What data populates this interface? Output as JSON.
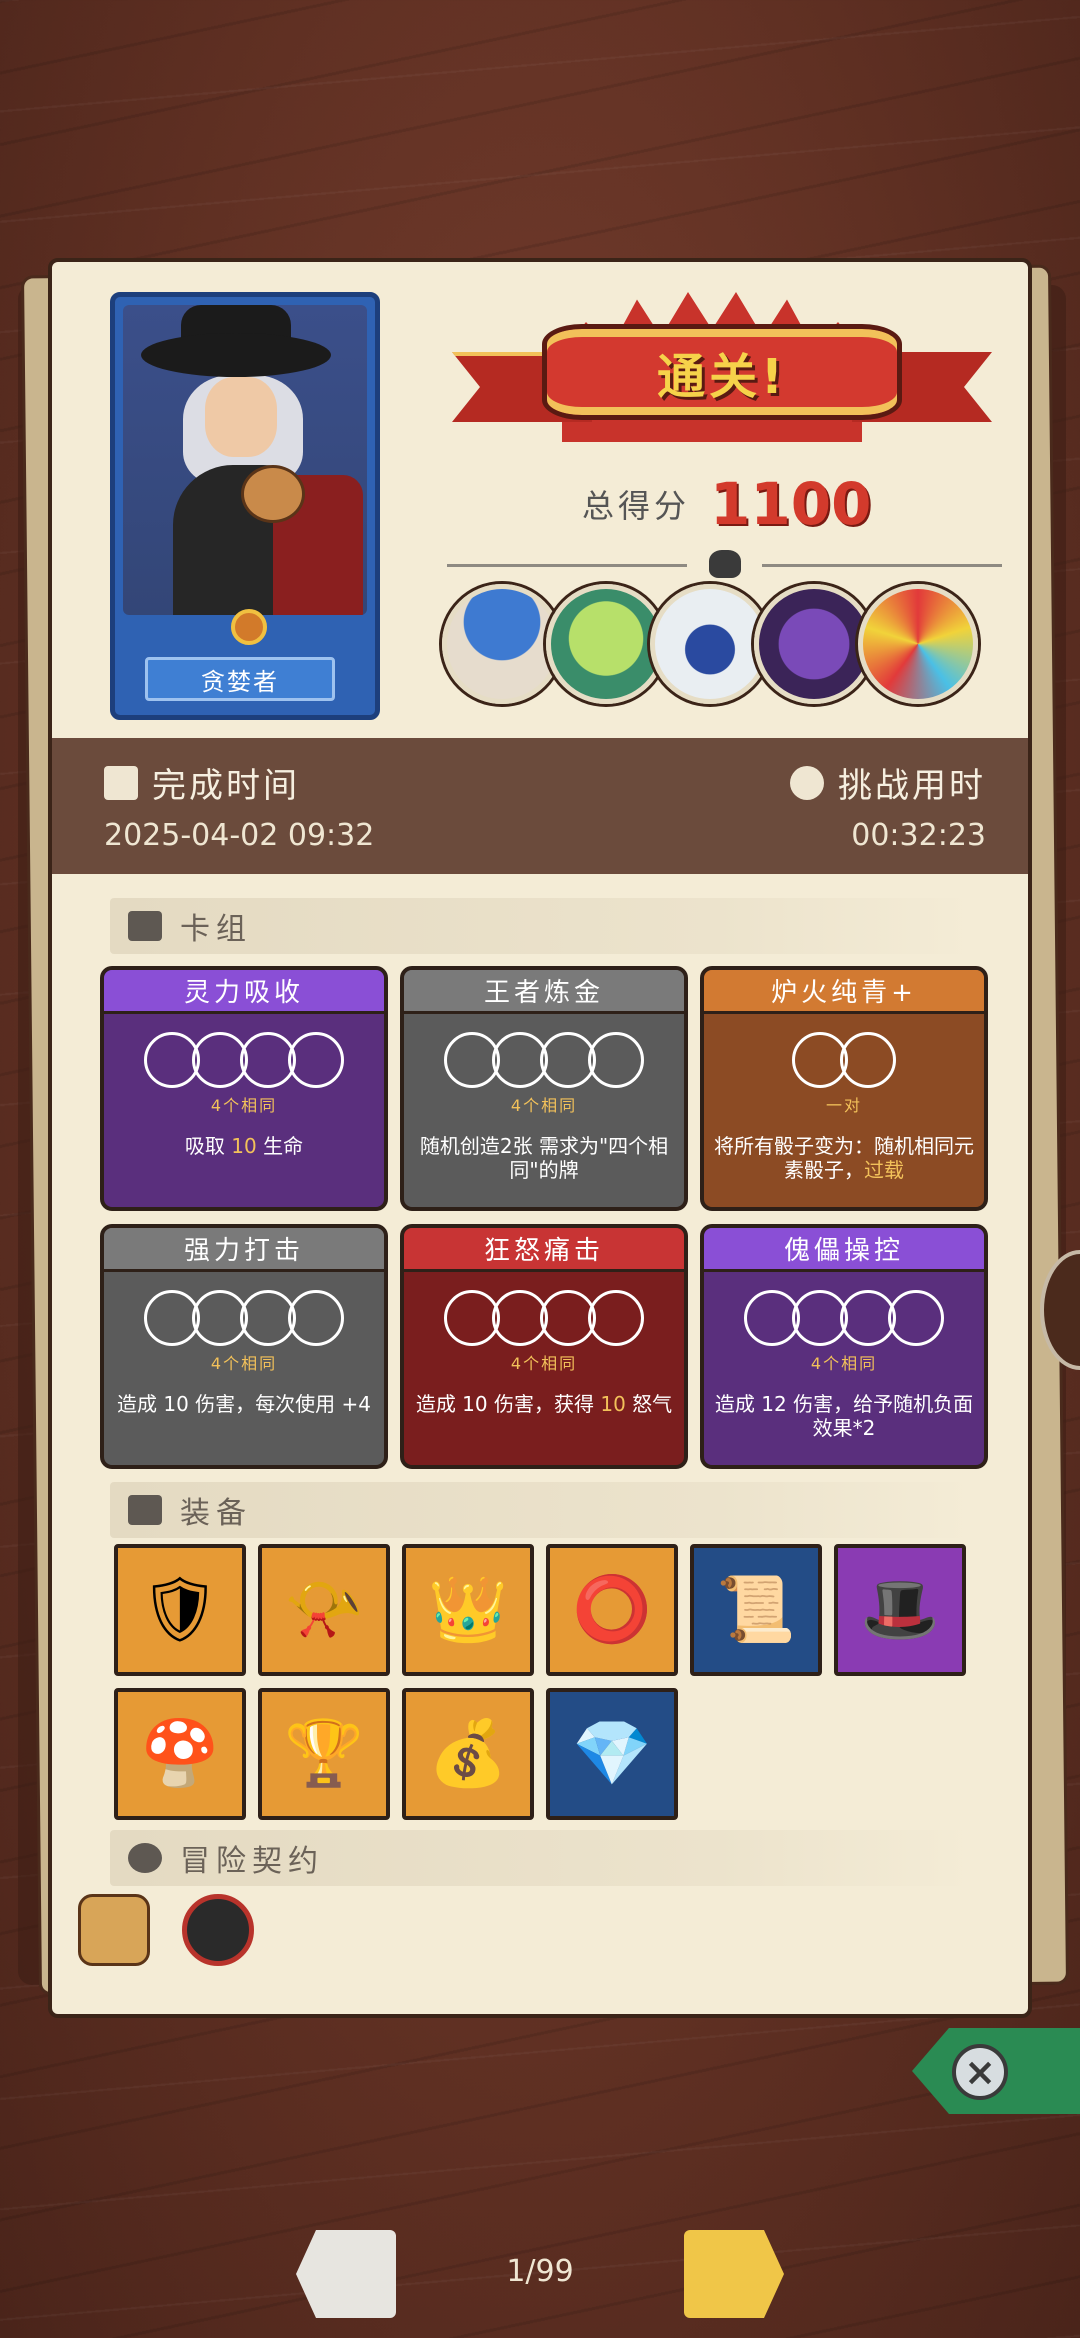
{
  "hero": {
    "name": "贪婪者"
  },
  "result": {
    "banner": "通关!",
    "score_label": "总得分",
    "score_value": "1100"
  },
  "bosses": [
    "boss-mushroom",
    "boss-green-goblin",
    "boss-white-yeti",
    "boss-purple-dragon",
    "boss-rainbow-egg"
  ],
  "times": {
    "finish_label": "完成时间",
    "finish_value": "2025-04-02 09:32",
    "duration_label": "挑战用时",
    "duration_value": "00:32:23"
  },
  "deck": {
    "title": "卡组",
    "cards": [
      {
        "title": "灵力吸收",
        "req": "4个相同",
        "desc_pre": "吸取 ",
        "desc_hl": "10",
        "desc_post": " 生命",
        "color": "purple",
        "circles": 4
      },
      {
        "title": "王者炼金",
        "req": "4个相同",
        "desc_pre": "随机创造2张 需求为\"四个相同\"的牌",
        "desc_hl": "",
        "desc_post": "",
        "color": "gray",
        "circles": 4
      },
      {
        "title": "炉火纯青+",
        "req": "一对",
        "desc_pre": "将所有骰子变为：随机相同元素骰子，",
        "desc_hl": "过载",
        "desc_post": "",
        "color": "orange",
        "circles": 2
      },
      {
        "title": "强力打击",
        "req": "4个相同",
        "desc_pre": "造成 10 伤害，每次使用 +4",
        "desc_hl": "",
        "desc_post": "",
        "color": "gray",
        "circles": 4
      },
      {
        "title": "狂怒痛击",
        "req": "4个相同",
        "desc_pre": "造成 10 伤害，获得 ",
        "desc_hl": "10",
        "desc_post": " 怒气",
        "color": "red",
        "circles": 4
      },
      {
        "title": "傀儡操控",
        "req": "4个相同",
        "desc_pre": "造成 12 伤害，给予随机负面效果*2",
        "desc_hl": "",
        "desc_post": "",
        "color": "purple",
        "circles": 4
      }
    ]
  },
  "equipment": {
    "title": "装备",
    "items": [
      {
        "icon": "blue-shield-icon",
        "glyph": "🛡",
        "bg": "orange"
      },
      {
        "icon": "horn-icon",
        "glyph": "📯",
        "bg": "orange"
      },
      {
        "icon": "crown-icon",
        "glyph": "👑",
        "bg": "orange"
      },
      {
        "icon": "round-shield-icon",
        "glyph": "⭕",
        "bg": "orange"
      },
      {
        "icon": "scroll-icon",
        "glyph": "📜",
        "bg": "blue"
      },
      {
        "icon": "feather-hat-icon",
        "glyph": "🎩",
        "bg": "purple"
      },
      {
        "icon": "mushrooms-icon",
        "glyph": "🍄",
        "bg": "orange"
      },
      {
        "icon": "goblet-icon",
        "glyph": "🏆",
        "bg": "orange"
      },
      {
        "icon": "sack-icon",
        "glyph": "💰",
        "bg": "orange"
      },
      {
        "icon": "diamond-icon",
        "glyph": "💎",
        "bg": "blue"
      }
    ]
  },
  "contracts": {
    "title": "冒险契约",
    "items": [
      "scroll-contract-icon",
      "red-rune-icon"
    ]
  },
  "pager": {
    "page": "1/99"
  },
  "colors": {
    "accent_red": "#d33a2c",
    "ribbon": "#d3392f",
    "close_green": "#2a8b53",
    "next_yellow": "#f0c648"
  }
}
